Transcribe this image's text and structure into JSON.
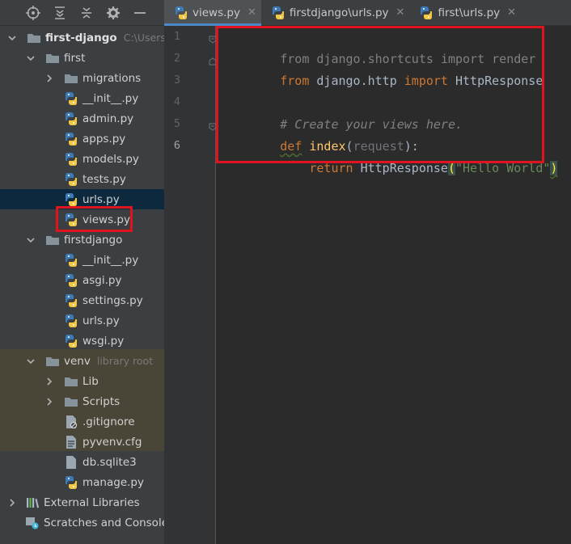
{
  "project_panel": {
    "toolbar_icons": [
      "locate-icon",
      "expand-all-icon",
      "collapse-all-icon",
      "gear-icon",
      "minimize-icon"
    ],
    "tree": [
      {
        "label": "first-django",
        "hint": "C:\\Users\\",
        "type": "folder",
        "depth": 0,
        "expanded": true,
        "bold": true
      },
      {
        "label": "first",
        "type": "folder",
        "depth": 1,
        "expanded": true
      },
      {
        "label": "migrations",
        "type": "folder",
        "depth": 2,
        "expanded": false
      },
      {
        "label": "__init__.py",
        "type": "python",
        "depth": 3
      },
      {
        "label": "admin.py",
        "type": "python",
        "depth": 3
      },
      {
        "label": "apps.py",
        "type": "python",
        "depth": 3
      },
      {
        "label": "models.py",
        "type": "python",
        "depth": 3
      },
      {
        "label": "tests.py",
        "type": "python",
        "depth": 3
      },
      {
        "label": "urls.py",
        "type": "python",
        "depth": 3,
        "selected": true
      },
      {
        "label": "views.py",
        "type": "python",
        "depth": 3
      },
      {
        "label": "firstdjango",
        "type": "folder",
        "depth": 1,
        "expanded": true
      },
      {
        "label": "__init__.py",
        "type": "python",
        "depth": 3
      },
      {
        "label": "asgi.py",
        "type": "python",
        "depth": 3
      },
      {
        "label": "settings.py",
        "type": "python",
        "depth": 3
      },
      {
        "label": "urls.py",
        "type": "python",
        "depth": 3
      },
      {
        "label": "wsgi.py",
        "type": "python",
        "depth": 3
      },
      {
        "label": "venv",
        "hint": "library root",
        "type": "folder",
        "depth": 1,
        "expanded": true
      },
      {
        "label": "Lib",
        "type": "folder",
        "depth": 2,
        "expanded": false
      },
      {
        "label": "Scripts",
        "type": "folder",
        "depth": 2,
        "expanded": false
      },
      {
        "label": ".gitignore",
        "type": "ignore",
        "depth": 3
      },
      {
        "label": "pyvenv.cfg",
        "type": "cfg",
        "depth": 3
      },
      {
        "label": "db.sqlite3",
        "type": "db",
        "depth": 2
      },
      {
        "label": "manage.py",
        "type": "python",
        "depth": 2
      },
      {
        "label": "External Libraries",
        "type": "libs",
        "depth": 0,
        "expanded": false
      },
      {
        "label": "Scratches and Consoles",
        "type": "scratch",
        "depth": 0
      }
    ]
  },
  "tabs": [
    {
      "label": "views.py",
      "active": true
    },
    {
      "label": "firstdjango\\urls.py",
      "active": false
    },
    {
      "label": "first\\urls.py",
      "active": false
    }
  ],
  "editor": {
    "line_numbers": [
      "1",
      "2",
      "3",
      "4",
      "5",
      "6"
    ],
    "current_line": "6",
    "code": {
      "l1": {
        "kw1": "from",
        "mod": " django.shortcuts ",
        "kw2": "import",
        "name": " render"
      },
      "l2": {
        "kw1": "from",
        "mod": " django.http ",
        "kw2": "import",
        "name": " HttpResponse"
      },
      "l4": {
        "comment": "# Create your views here."
      },
      "l5": {
        "kw": "def",
        "fn": "index",
        "open": "(",
        "param": "request",
        "close": "):"
      },
      "l6": {
        "indent": "    ",
        "kw": "return",
        "call": " HttpResponse",
        "open": "(",
        "str": "\"Hello World\"",
        "close": ")"
      }
    }
  },
  "colors": {
    "highlight_box": "#e0141e",
    "keyword": "#cc7832",
    "function": "#ffc66d",
    "string": "#6a8759",
    "comment": "#808080"
  }
}
